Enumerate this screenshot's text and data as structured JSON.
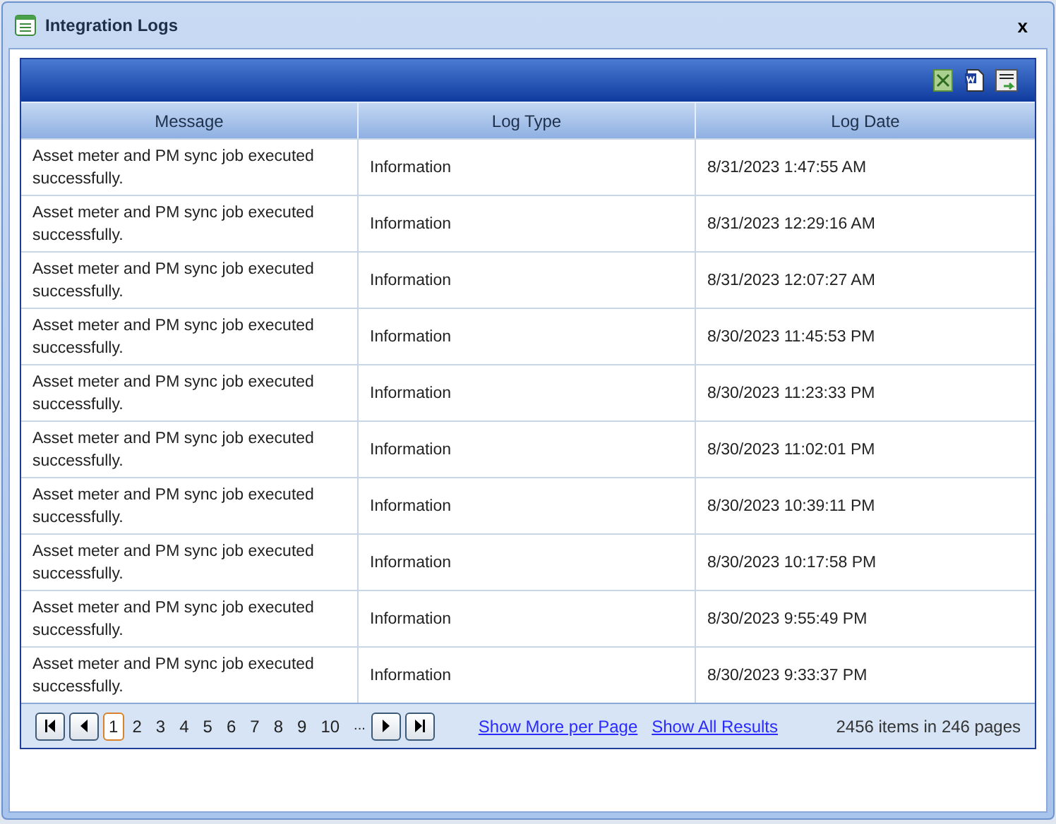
{
  "window": {
    "title": "Integration Logs",
    "close": "x"
  },
  "toolbar": {
    "exports": [
      {
        "kind": "excel"
      },
      {
        "kind": "word"
      },
      {
        "kind": "csv"
      }
    ]
  },
  "table": {
    "columns": [
      "Message",
      "Log Type",
      "Log Date"
    ],
    "rows": [
      [
        "Asset meter and PM sync job executed successfully.",
        "Information",
        "8/31/2023 1:47:55 AM"
      ],
      [
        "Asset meter and PM sync job executed successfully.",
        "Information",
        "8/31/2023 12:29:16 AM"
      ],
      [
        "Asset meter and PM sync job executed successfully.",
        "Information",
        "8/31/2023 12:07:27 AM"
      ],
      [
        "Asset meter and PM sync job executed successfully.",
        "Information",
        "8/30/2023 11:45:53 PM"
      ],
      [
        "Asset meter and PM sync job executed successfully.",
        "Information",
        "8/30/2023 11:23:33 PM"
      ],
      [
        "Asset meter and PM sync job executed successfully.",
        "Information",
        "8/30/2023 11:02:01 PM"
      ],
      [
        "Asset meter and PM sync job executed successfully.",
        "Information",
        "8/30/2023 10:39:11 PM"
      ],
      [
        "Asset meter and PM sync job executed successfully.",
        "Information",
        "8/30/2023 10:17:58 PM"
      ],
      [
        "Asset meter and PM sync job executed successfully.",
        "Information",
        "8/30/2023 9:55:49 PM"
      ],
      [
        "Asset meter and PM sync job executed successfully.",
        "Information",
        "8/30/2023 9:33:37 PM"
      ]
    ]
  },
  "pager": {
    "pages": [
      {
        "label": "1",
        "selected": true
      },
      {
        "label": "2",
        "selected": false
      },
      {
        "label": "3",
        "selected": false
      },
      {
        "label": "4",
        "selected": false
      },
      {
        "label": "5",
        "selected": false
      },
      {
        "label": "6",
        "selected": false
      },
      {
        "label": "7",
        "selected": false
      },
      {
        "label": "8",
        "selected": false
      },
      {
        "label": "9",
        "selected": false
      },
      {
        "label": "10",
        "selected": false
      }
    ],
    "more": "...",
    "links": [
      "Show More per Page",
      "Show All Results"
    ],
    "summary": "2456 items in 246 pages"
  }
}
